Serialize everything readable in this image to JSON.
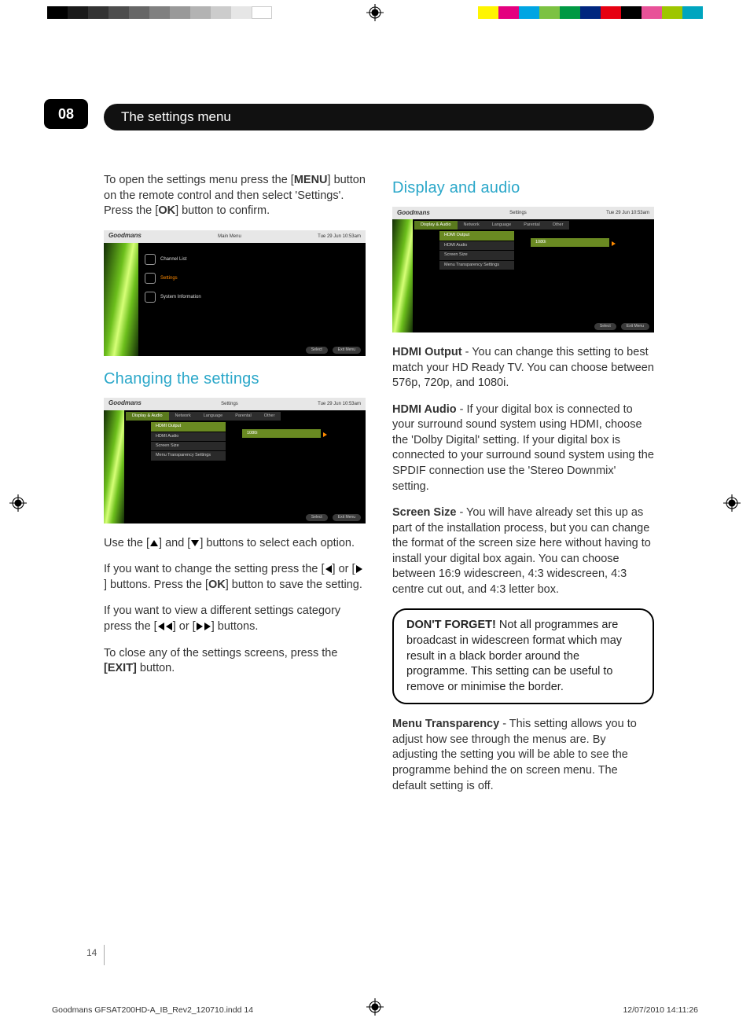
{
  "page": {
    "chapter_number": "08",
    "chapter_title": "The settings menu",
    "page_number": "14"
  },
  "slug": {
    "file": "Goodmans GFSAT200HD-A_IB_Rev2_120710.indd   14",
    "stamp": "12/07/2010   14:11:26"
  },
  "colL": {
    "intro1a": "To open the settings menu press the [",
    "intro1_menu": "MENU",
    "intro1b": "] button on the remote control and then select 'Settings'.",
    "intro2a": "Press the [",
    "intro2_ok": "OK",
    "intro2b": "] button to confirm.",
    "sub_changing": "Changing the settings",
    "use_a": "Use the [",
    "use_b": "] and [",
    "use_c": "] buttons to select each option.",
    "change_a": "If you want to change the setting press the  [",
    "change_b": "] or  [",
    "change_c": "]  buttons. Press the [",
    "change_ok": "OK",
    "change_d": "] button to save the setting.",
    "cat_a": "If you want to view a different settings category press the  [",
    "cat_b": "] or  [",
    "cat_c": "]  buttons.",
    "close_a": "To close any of the settings screens, press the ",
    "close_exit": "[EXIT]",
    "close_b": " button."
  },
  "colR": {
    "sub_display": "Display and audio",
    "hdmi_out_h": "HDMI Output",
    "hdmi_out_t": " - You can change this setting to best match your HD Ready TV. You can choose between 576p, 720p, and 1080i.",
    "hdmi_aud_h": "HDMI Audio",
    "hdmi_aud_t": " - If your digital box is connected to your surround sound system using HDMI, choose the 'Dolby Digital' setting. If your digital box is connected to your surround sound system using the SPDIF connection use the 'Stereo Downmix' setting.",
    "scr_h": "Screen Size",
    "scr_t": " - You will have already set this up as part of the installation process, but you can change the format of the screen size here without having to install your digital box again. You can choose between 16:9 widescreen, 4:3 widescreen, 4:3 centre cut out, and 4:3 letter box.",
    "dont_h": "DON'T FORGET!",
    "dont_t": " Not all programmes are broadcast in widescreen format which may result in a black border around the programme. This setting can be useful to remove or minimise the border.",
    "mt_h": "Menu Transparency",
    "mt_t": " - This setting allows you to adjust how see through the menus are. By adjusting the setting you will be able to see the programme behind the on screen menu. The default setting is off."
  },
  "shots": {
    "brand": "Goodmans",
    "clock": "Tue 29 Jun 10:53am",
    "main_title": "Main Menu",
    "settings_title": "Settings",
    "main_items": {
      "a": "Channel List",
      "b": "Settings",
      "c": "System Information"
    },
    "tabs": {
      "a": "Display & Audio",
      "b": "Network",
      "c": "Language",
      "d": "Parental",
      "e": "Other"
    },
    "opts": {
      "a": "HDMI Output",
      "b": "HDMI Audio",
      "c": "Screen Size",
      "d": "Menu Transparency Settings"
    },
    "val_1080i": "1080i",
    "f_select": "Select",
    "f_exit": "Exit Menu"
  },
  "swatches": {
    "left": [
      "#000",
      "#1a1a1a",
      "#333",
      "#4d4d4d",
      "#666",
      "#808080",
      "#999",
      "#b3b3b3",
      "#ccc",
      "#e6e6e6",
      "#fff"
    ],
    "right": [
      "#fff501",
      "#e4007f",
      "#00a5e3",
      "#7cc242",
      "#009944",
      "#00267f",
      "#e60012",
      "#000",
      "#e85298",
      "#9ec600",
      "#00a5bf"
    ]
  }
}
